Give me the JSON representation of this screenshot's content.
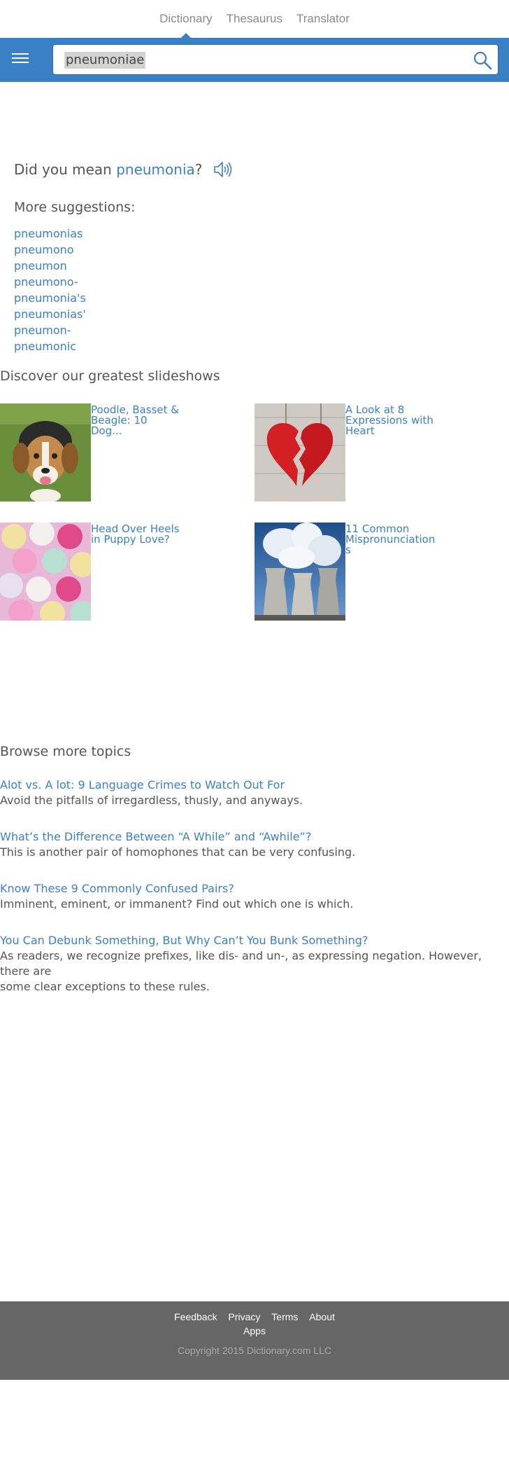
{
  "top_tabs": [
    {
      "label": "Dictionary",
      "active": true
    },
    {
      "label": "Thesaurus",
      "active": false
    },
    {
      "label": "Translator",
      "active": false
    }
  ],
  "search": {
    "value": "pneumoniae",
    "icon": "search-icon"
  },
  "did_you_mean": {
    "prefix": "Did you mean ",
    "word": "pneumonia",
    "suffix": "?"
  },
  "more_suggestions": {
    "title": "More suggestions:",
    "items": [
      "pneumonias",
      "pneumono",
      "pneumon",
      "pneumono-",
      "pneumonia's",
      "pneumonias'",
      "pneumon-",
      "pneumonic"
    ]
  },
  "slideshows": {
    "title": "Discover our greatest slideshows",
    "items": [
      {
        "caption_lines": [
          "Poodle, Basset &",
          "Beagle: 10",
          "Dog..."
        ]
      },
      {
        "caption_lines": [
          "A Look at 8",
          "Expressions with",
          "Heart"
        ]
      },
      {
        "caption_lines": [
          "Head Over Heels",
          "in Puppy Love?"
        ]
      },
      {
        "caption_lines": [
          "11 Common",
          "Mispronunciation",
          "s"
        ]
      }
    ]
  },
  "browse": {
    "title": "Browse more topics",
    "topics": [
      {
        "title": "Alot vs. A lot: 9 Language Crimes to Watch Out For",
        "desc": "Avoid the pitfalls of irregardless, thusly, and anyways."
      },
      {
        "title": "What’s the Difference Between “A While” and “Awhile”?",
        "desc": "This is another pair of homophones that can be very confusing."
      },
      {
        "title": "Know These 9 Commonly Confused Pairs?",
        "desc": "Imminent, eminent, or immanent? Find out which one is which."
      },
      {
        "title": "You Can Debunk Something, But Why Can’t You Bunk Something?",
        "desc_lines": [
          "As readers, we recognize prefixes, like dis- and un-, as expressing negation. However, there are",
          "some clear exceptions to these rules."
        ]
      }
    ]
  },
  "footer": {
    "links": [
      "Feedback",
      "Privacy",
      "Terms",
      "About"
    ],
    "apps": "Apps",
    "copyright": "Copyright 2015 Dictionary.com LLC"
  },
  "colors": {
    "brand_blue": "#3b7fc4",
    "footer_gray": "#666666"
  }
}
